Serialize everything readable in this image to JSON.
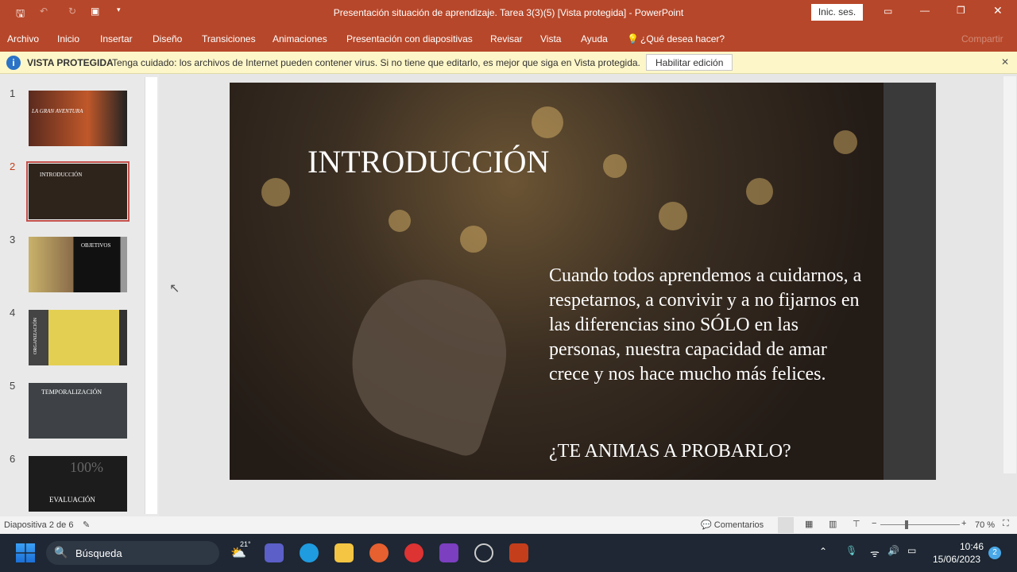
{
  "window": {
    "title": "Presentación situación de aprendizaje. Tarea 3(3)(5) [Vista protegida]  -  PowerPoint",
    "signin": "Inic. ses."
  },
  "menu": [
    "Archivo",
    "Inicio",
    "Insertar",
    "Diseño",
    "Transiciones",
    "Animaciones",
    "Presentación con diapositivas",
    "Revisar",
    "Vista",
    "Ayuda",
    "¿Qué desea hacer?"
  ],
  "share": "Compartir",
  "protected": {
    "label": "VISTA PROTEGIDA",
    "message": "Tenga cuidado: los archivos de Internet pueden contener virus. Si no tiene que editarlo, es mejor que siga en Vista protegida.",
    "button": "Habilitar edición"
  },
  "thumbnails": [
    {
      "num": "1",
      "title": "LA GRAN AVENTURA"
    },
    {
      "num": "2",
      "title": "INTRODUCCIÓN"
    },
    {
      "num": "3",
      "title": "OBJETIVOS"
    },
    {
      "num": "4",
      "title": "ORGANIZACIÓN"
    },
    {
      "num": "5",
      "title": "TEMPORALIZACIÓN"
    },
    {
      "num": "6",
      "title": "EVALUACIÓN",
      "extra": "100%"
    }
  ],
  "slide": {
    "title": "INTRODUCCIÓN",
    "body": "Cuando todos aprendemos a cuidarnos, a respetarnos, a convivir y a no fijarnos en las diferencias sino SÓLO en las personas, nuestra capacidad de amar crece y nos hace mucho más felices.",
    "question": "¿TE ANIMAS A PROBARLO?"
  },
  "status": {
    "slide_info": "Diapositiva 2 de 6",
    "comments": "Comentarios",
    "zoom": "70 %",
    "zoom_value": 70
  },
  "taskbar": {
    "search": "Búsqueda",
    "weather": "21°",
    "time": "10:46",
    "date": "15/06/2023",
    "notifications": "2"
  }
}
